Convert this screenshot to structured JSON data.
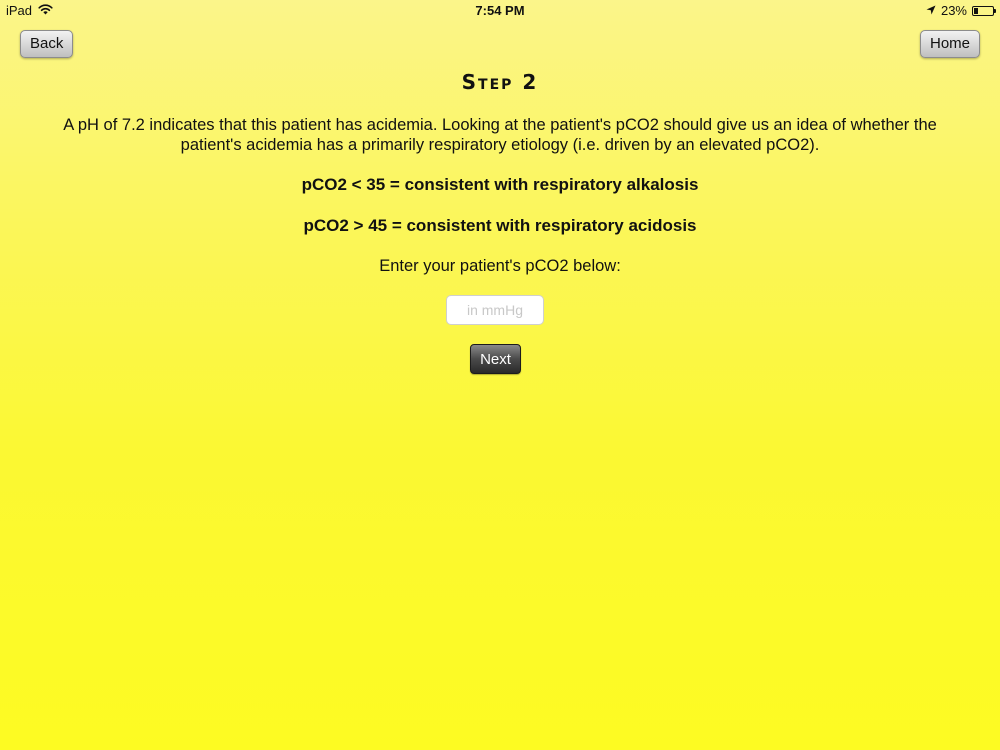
{
  "status_bar": {
    "device": "iPad",
    "time": "7:54 PM",
    "battery_percent": "23%",
    "battery_level": 0.23,
    "icons": [
      "wifi-icon",
      "location-arrow-icon",
      "battery-icon"
    ]
  },
  "nav": {
    "back_label": "Back",
    "home_label": "Home"
  },
  "content": {
    "step_title": "Step 2",
    "intro_text": "A pH of 7.2 indicates that this patient has acidemia. Looking at the patient's pCO2 should give us an idea of whether the patient's acidemia has a primarily respiratory etiology (i.e. driven by an elevated pCO2).",
    "rule_low": "pCO2 < 35 = consistent with respiratory alkalosis",
    "rule_high": "pCO2 > 45 = consistent with respiratory acidosis",
    "prompt": "Enter your patient's pCO2 below:"
  },
  "form": {
    "pco2_value": "",
    "pco2_placeholder": "in mmHg",
    "next_label": "Next"
  },
  "colors": {
    "background_top": "#fbf58a",
    "background_bottom": "#fdfb22",
    "next_button": "#3a3a3a"
  }
}
